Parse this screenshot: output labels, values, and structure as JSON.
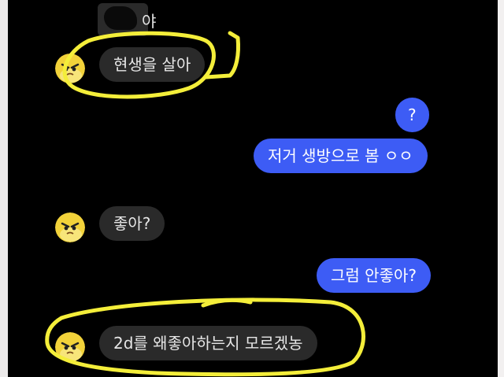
{
  "conversation": {
    "messages": [
      {
        "side": "in",
        "text": "야",
        "partially_redacted": true
      },
      {
        "side": "in",
        "text": "현생을 살아",
        "highlighted": true
      },
      {
        "side": "out",
        "text": "?"
      },
      {
        "side": "out",
        "text": "저거 생방으로 봄 ㅇㅇ"
      },
      {
        "side": "in",
        "text": "좋아?"
      },
      {
        "side": "out",
        "text": "그럼 안좋아?"
      },
      {
        "side": "in",
        "text": "2d를 왜좋아하는지 모르겠농",
        "highlighted": true
      }
    ]
  },
  "avatar": {
    "icon": "yellow-cartoon-face-avatar",
    "color": "#f2d23a"
  },
  "colors": {
    "background": "#000000",
    "incoming_bubble": "#2a2a2a",
    "outgoing_bubble": "#3d5cf5",
    "highlight_marker": "#f4ee3a"
  }
}
